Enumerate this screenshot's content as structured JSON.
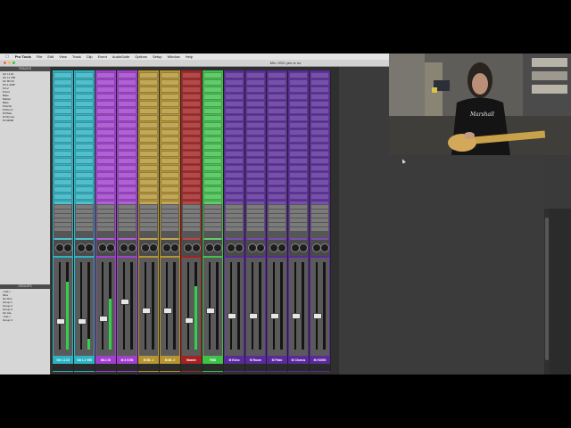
{
  "menubar": {
    "apple": "",
    "app": "Pro Tools",
    "items": [
      "File",
      "Edit",
      "View",
      "Track",
      "Clip",
      "Event",
      "AudioSuite",
      "Options",
      "Setup",
      "Window",
      "Help"
    ]
  },
  "window": {
    "title": "Mix: HSG yes or no"
  },
  "left_panel": {
    "tracks_header": "TRACKS",
    "tracks": [
      "Gtr L1 DI",
      "Gtr L1 VIB",
      "Gtr R2 DI",
      "M L1 AMP",
      "M L2",
      "M Ant",
      "Bass",
      "Master",
      "Bass",
      "M Echo",
      "M Room",
      "M Plate",
      "M Chorus",
      "M H3000"
    ],
    "groups_header": "GROUPS",
    "groups": [
      "<ALL>",
      "Mics",
      "Gtr Dirs",
      "Group 1",
      "Group 2",
      "Group 3",
      "Gtr ALL",
      "<ALL>",
      "Group 3"
    ]
  },
  "strips": [
    {
      "name": "Gtr L1 DI",
      "color": "#2bb3c4",
      "fader": 0.32,
      "meter": 0.78
    },
    {
      "name": "Gtr L1 VIB",
      "color": "#2bb3c4",
      "fader": 0.32,
      "meter": 0.12
    },
    {
      "name": "ML1 DI",
      "color": "#a23ed0",
      "fader": 0.35,
      "meter": 0.58
    },
    {
      "name": "M 3 KXN",
      "color": "#a23ed0",
      "fader": 0.55,
      "meter": 0.0
    },
    {
      "name": "M ML 1",
      "color": "#b59431",
      "fader": 0.45,
      "meter": 0.0
    },
    {
      "name": "M ML 2",
      "color": "#b59431",
      "fader": 0.45,
      "meter": 0.0
    },
    {
      "name": "Master",
      "color": "#a52222",
      "fader": 0.33,
      "meter": 0.72
    },
    {
      "name": "FM8",
      "color": "#3fc24a",
      "fader": 0.45,
      "meter": 0.0
    },
    {
      "name": "M Echo",
      "color": "#5a2a9c",
      "fader": 0.38,
      "meter": 0.0
    },
    {
      "name": "M Room",
      "color": "#5a2a9c",
      "fader": 0.38,
      "meter": 0.0
    },
    {
      "name": "M Plate",
      "color": "#5a2a9c",
      "fader": 0.38,
      "meter": 0.0
    },
    {
      "name": "M Chorus",
      "color": "#5a2a9c",
      "fader": 0.38,
      "meter": 0.0
    },
    {
      "name": "M H3000",
      "color": "#5a2a9c",
      "fader": 0.38,
      "meter": 0.0
    }
  ],
  "webcam": {
    "shirt_text": "Marshall"
  }
}
